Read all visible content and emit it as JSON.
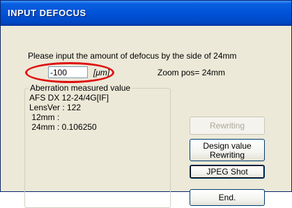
{
  "window": {
    "title": "INPUT DEFOCUS"
  },
  "prompt": "Please input the amount of defocus by the side of   24mm",
  "defocus": {
    "value": "-100",
    "unit": "[μm]"
  },
  "zoom_label": "Zoom pos= 24mm",
  "aberration": {
    "legend": "Aberration measured value",
    "lines": [
      "AFS DX 12-24/4G[IF]",
      "LensVer : 122",
      " 12mm :",
      " 24mm : 0.106250"
    ]
  },
  "buttons": {
    "rewriting": "Rewriting",
    "design_line1": "Design value",
    "design_line2": "Rewriting",
    "jpeg": "JPEG Shot",
    "end": "End."
  },
  "colors": {
    "titlebar": "#0052d6",
    "highlight": "#e01010",
    "face": "#ece9d8"
  }
}
